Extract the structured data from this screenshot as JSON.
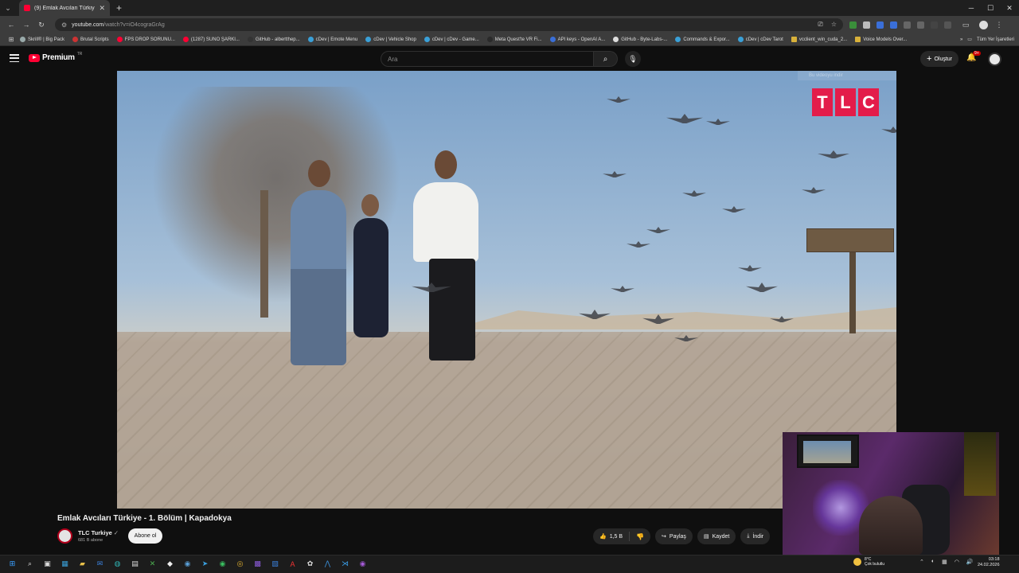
{
  "browser": {
    "tab_title": "(9) Emlak Avcıları Türkiye - 1. B",
    "url_host": "youtube.com",
    "url_path": "/watch?v=iO4cograGrAg",
    "bookmarks": [
      "Skrill® | Big Pack",
      "Brutal Scripts",
      "FPS DROP SORUNU...",
      "(1287) SUNO ŞARKI...",
      "GitHub - albertthep...",
      "cDev | Emote Menu",
      "cDev | Vehicle Shop",
      "cDev | cDev - Game...",
      "Meta Quest'te VR Fi...",
      "API keys - OpenAI A...",
      "GitHub - Byte-Labs-...",
      "Commands & Expor...",
      "cDev | cDev Tarot",
      "vcclient_win_cuda_2...",
      "Voice Models Over..."
    ],
    "all_bookmarks": "Tüm Yer İşaretleri"
  },
  "youtube": {
    "logo_text": "Premium",
    "country": "TR",
    "search_placeholder": "Ara",
    "create_label": "Oluştur",
    "notifications": "9+"
  },
  "video": {
    "download_hint": "Bu videoyu indir",
    "brand_letters": [
      "T",
      "L",
      "C"
    ],
    "title": "Emlak Avcıları Türkiye - 1. Bölüm | Kapadokya",
    "channel": "TLC Turkiye",
    "subscribers": "681 B abone",
    "subscribe_label": "Abone ol",
    "likes": "1,5 B",
    "share_label": "Paylaş",
    "save_label": "Kaydet",
    "download_label": "İndir"
  },
  "taskbar": {
    "weather_temp": "8°C",
    "weather_desc": "Çok bulutlu",
    "time": "03:18",
    "date": "24.02.2026"
  }
}
